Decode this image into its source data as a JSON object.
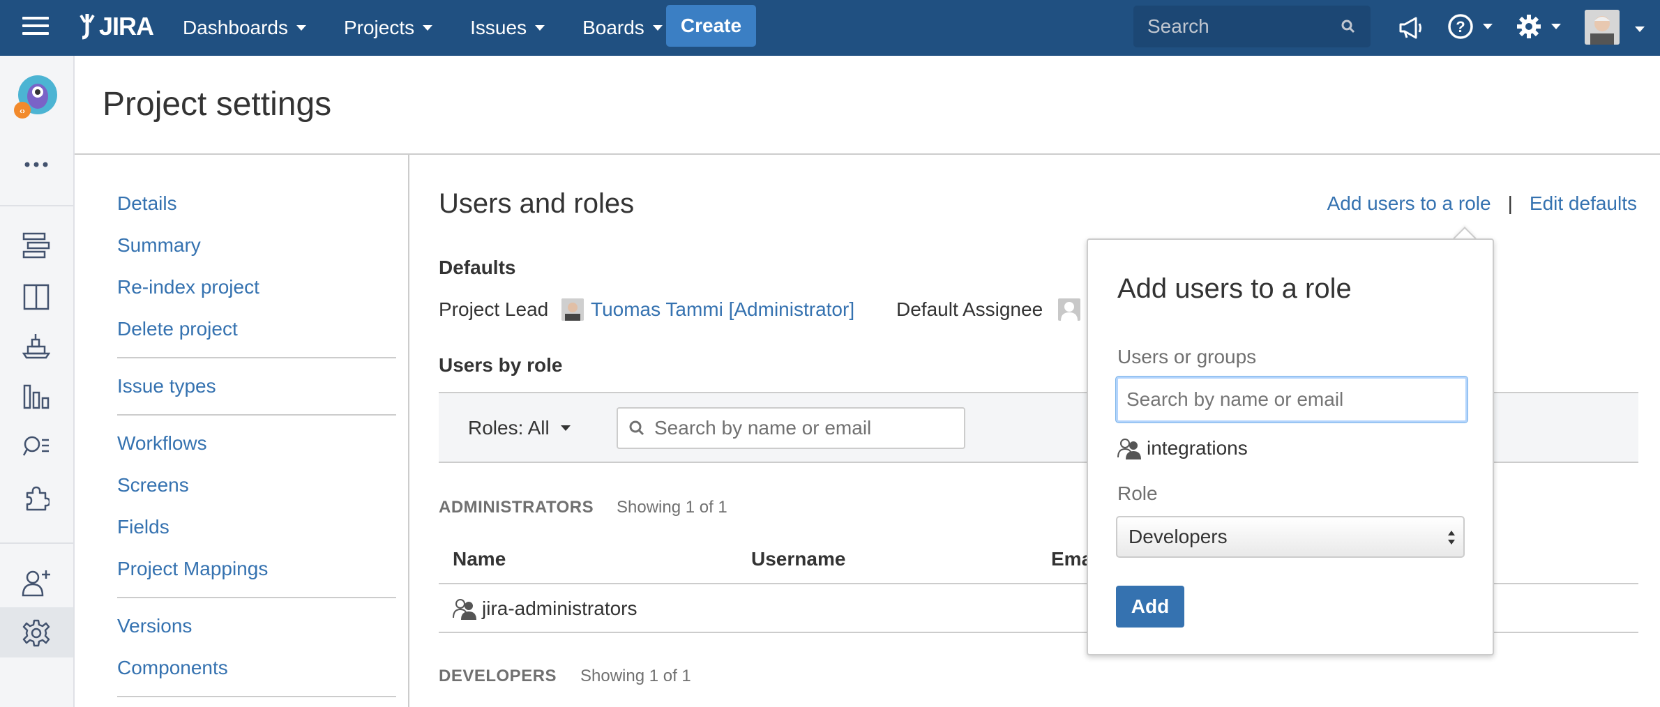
{
  "topnav": {
    "logo_text": "JIRA",
    "menu": [
      "Dashboards",
      "Projects",
      "Issues",
      "Boards"
    ],
    "create_label": "Create",
    "search_placeholder": "Search"
  },
  "header": {
    "title": "Project settings"
  },
  "settings_nav": {
    "groups": [
      [
        "Details",
        "Summary",
        "Re-index project",
        "Delete project"
      ],
      [
        "Issue types"
      ],
      [
        "Workflows",
        "Screens",
        "Fields",
        "Project Mappings"
      ],
      [
        "Versions",
        "Components"
      ]
    ]
  },
  "main": {
    "title": "Users and roles",
    "add_users_link": "Add users to a role",
    "separator": "|",
    "edit_defaults_link": "Edit defaults",
    "defaults_heading": "Defaults",
    "project_lead_label": "Project Lead",
    "project_lead_name": "Tuomas Tammi [Administrator]",
    "default_assignee_label": "Default Assignee",
    "users_by_role_heading": "Users by role",
    "roles_filter": "Roles: All",
    "search_placeholder": "Search by name or email",
    "sections": [
      {
        "label": "ADMINISTRATORS",
        "count": "Showing 1 of 1"
      },
      {
        "label": "DEVELOPERS",
        "count": "Showing 1 of 1"
      }
    ],
    "columns": [
      "Name",
      "Username",
      "Ema"
    ],
    "rows": [
      {
        "name": "jira-administrators"
      }
    ]
  },
  "dialog": {
    "title": "Add users to a role",
    "users_label": "Users or groups",
    "users_placeholder": "Search by name or email",
    "suggestion": "integrations",
    "role_label": "Role",
    "role_value": "Developers",
    "add_label": "Add"
  },
  "colors": {
    "nav_bg": "#205081",
    "link": "#3572b0",
    "create_btn": "#3b7fc4"
  }
}
